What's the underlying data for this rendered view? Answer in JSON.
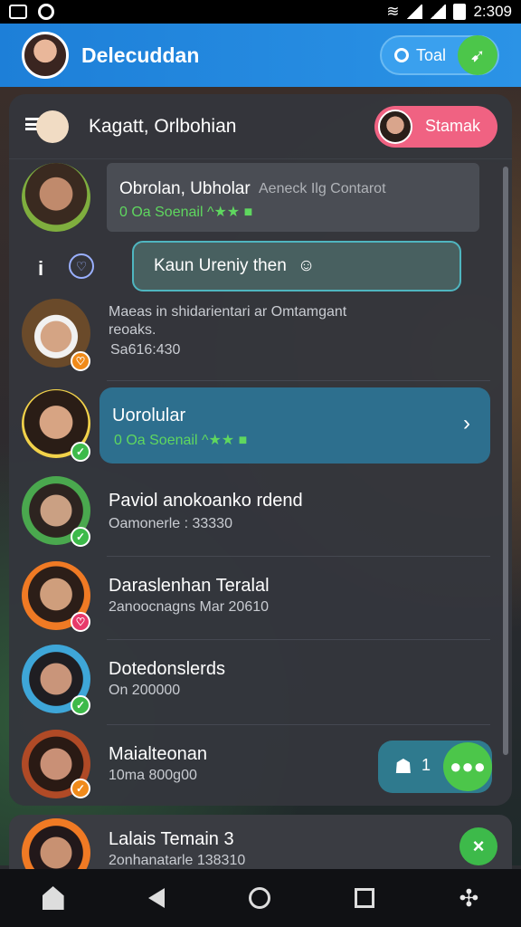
{
  "status_bar": {
    "time": "2:309"
  },
  "app_bar": {
    "title": "Delecuddan",
    "search_text": "Toal",
    "leaf_icon": "leaf-icon"
  },
  "panel": {
    "title": "Kagatt, Orlbohian",
    "start_button": "Stamak"
  },
  "rows": [
    {
      "name": "Obrolan, Ubholar",
      "extra": "Aeneck Ilg Contarot",
      "sub": "0 Oa Soenail ^★★ ■",
      "badge": ""
    },
    {
      "reply": "Kaun Ureniy then"
    },
    {
      "name": "Maeas in shidarientari ar Omtamgant",
      "name2": "reoaks.",
      "sub": "Sa616:430",
      "badge": "♡"
    },
    {
      "name": "Uorolular",
      "sub": "0 Oa Soenail ^★★ ■",
      "badge": "✓"
    },
    {
      "name": "Paviol anokoanko rdend",
      "sub": "Oamonerle : 33330",
      "badge": "✓"
    },
    {
      "name": "Daraslenhan Teralal",
      "sub": "2anoocnagns Mar 20610",
      "badge": "♡"
    },
    {
      "name": "Dotedonslerds",
      "sub": "On 200000",
      "badge": "✓"
    },
    {
      "name": "Maialteonan",
      "sub": "10ma 800g00",
      "badge": "✓"
    }
  ],
  "chat_pill": {
    "count": "1"
  },
  "bottom_card": {
    "name": "Lalais Temain 3",
    "sub": "2onhanatarle 138310"
  }
}
